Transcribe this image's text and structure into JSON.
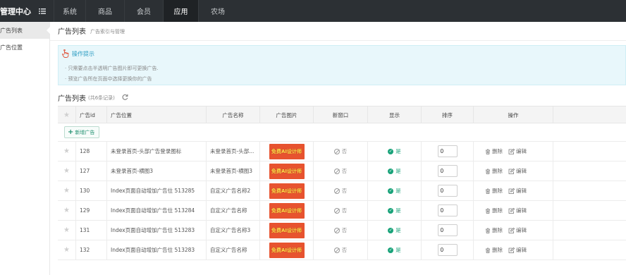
{
  "app": {
    "title": "管理中心"
  },
  "topnav": [
    {
      "label": "系统",
      "active": false
    },
    {
      "label": "商品",
      "active": false
    },
    {
      "label": "会员",
      "active": false
    },
    {
      "label": "应用",
      "active": true
    },
    {
      "label": "农场",
      "active": false
    }
  ],
  "sidebar": {
    "items": [
      {
        "label": "广告列表",
        "active": true
      },
      {
        "label": "广告位置",
        "active": false
      }
    ]
  },
  "page": {
    "title": "广告列表",
    "subtitle": "广告索引与管理"
  },
  "tips": {
    "title": "操作提示",
    "lines": [
      "只需要点击半透明广告图片即可更换广告.",
      "预览广告所在页面中选择更换你的广告"
    ]
  },
  "list": {
    "title": "广告列表",
    "count_text": "(共6条记录)"
  },
  "table": {
    "headers": {
      "id": "广告id",
      "position": "广告位置",
      "name": "广告名称",
      "image": "广告图片",
      "new_window": "新窗口",
      "show": "显示",
      "sort": "排序",
      "actions": "操作"
    },
    "add_button": "新增广告",
    "delete_label": "删除",
    "edit_label": "编辑",
    "no_label": "否",
    "yes_label": "是",
    "ad_image_text": "免费AI设计师",
    "rows": [
      {
        "id": "128",
        "position": "未登录首页-头部广告登录图标",
        "name": "未登录首页-头部...",
        "sort": "0"
      },
      {
        "id": "127",
        "position": "未登录首页-横图3",
        "name": "未登录首页-横图3",
        "sort": "0"
      },
      {
        "id": "130",
        "position": "Index页面自动增加广告位 513285",
        "name": "自定义广告名称2",
        "sort": "0"
      },
      {
        "id": "129",
        "position": "Index页面自动增加广告位 513284",
        "name": "自定义广告名称",
        "sort": "0"
      },
      {
        "id": "131",
        "position": "Index页面自动增加广告位 513283",
        "name": "自定义广告名称3",
        "sort": "0"
      },
      {
        "id": "132",
        "position": "Index页面自动增加广告位 513283",
        "name": "自定义广告名称",
        "sort": "0"
      }
    ]
  },
  "colors": {
    "topbar": "#2c3034",
    "accent_teal": "#1aa37a",
    "tips_bg": "#e8f7fb",
    "tips_title": "#2b9cc2",
    "ad_bg": "#e7532f"
  }
}
